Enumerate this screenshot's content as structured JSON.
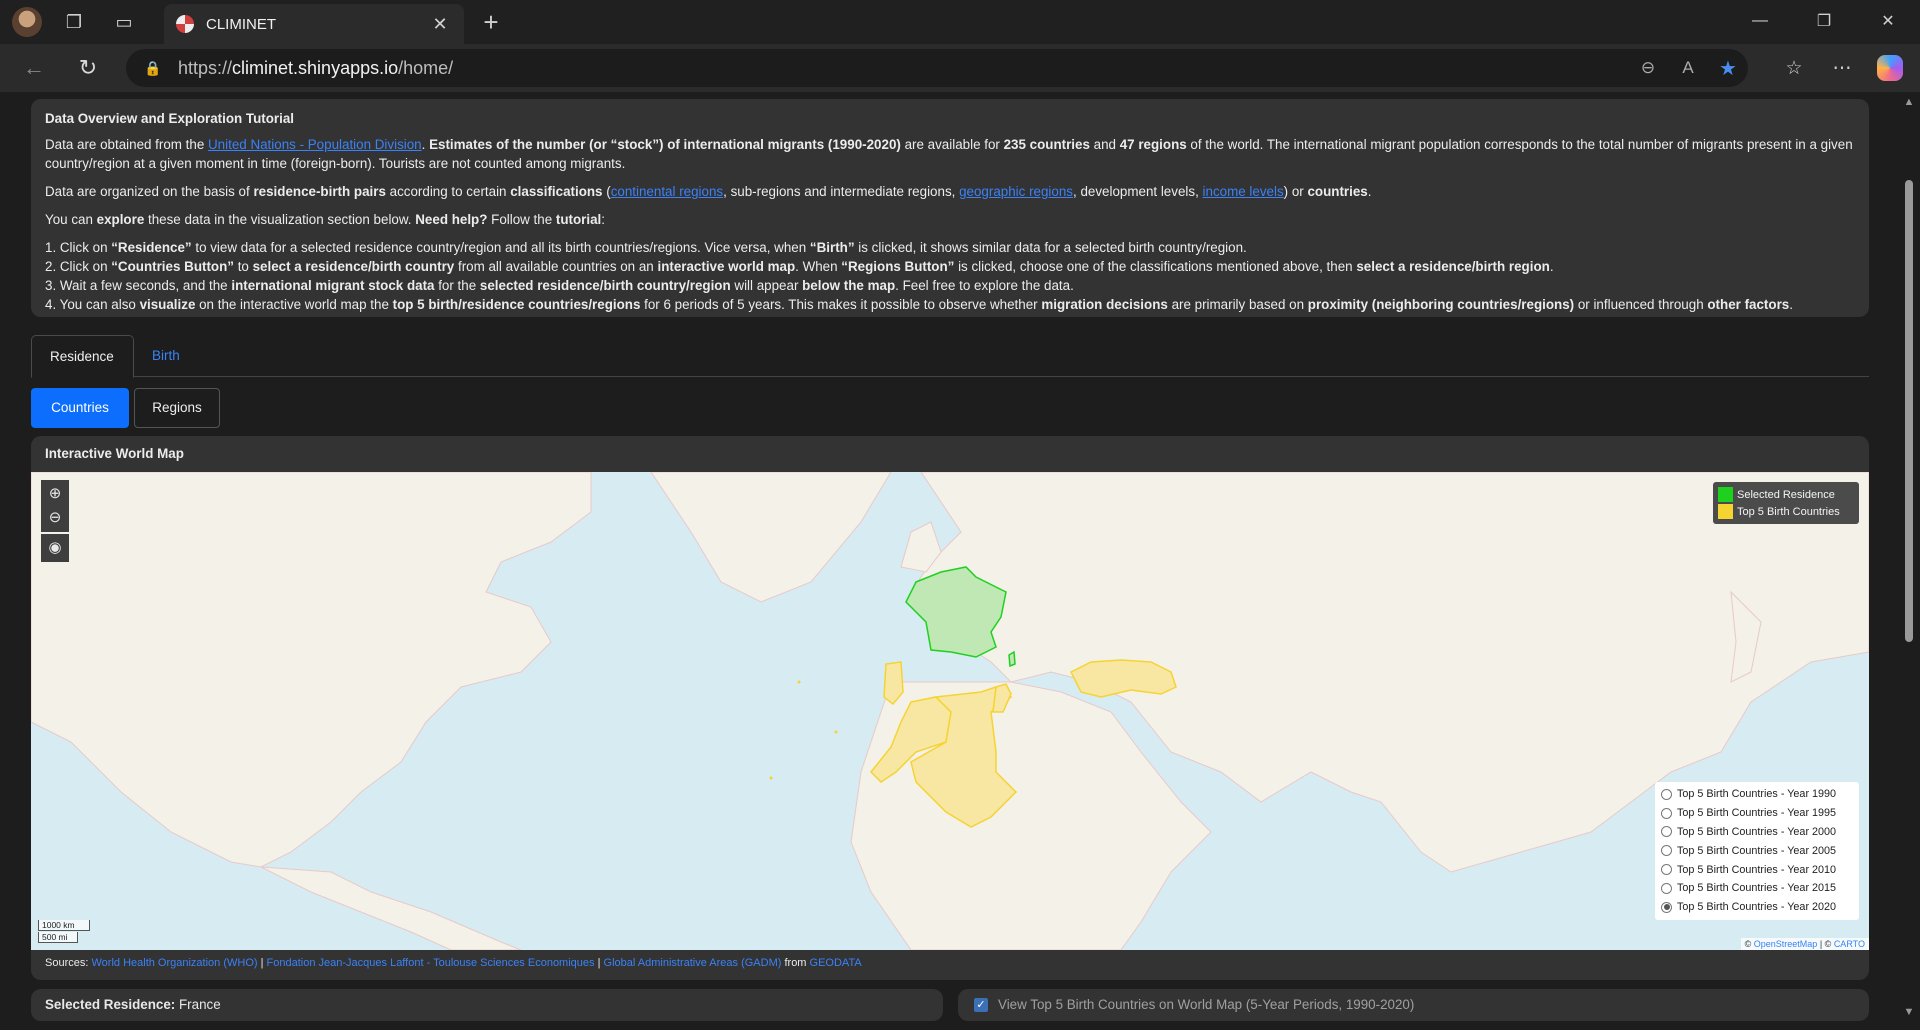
{
  "browser": {
    "tab_title": "CLIMINET",
    "url_prefix": "https://",
    "url_host": "climinet.shinyapps.io",
    "url_path": "/home/"
  },
  "tutorial": {
    "title": "Data Overview and Exploration Tutorial",
    "p1_a": "Data are obtained from the ",
    "p1_link": "United Nations - Population Division",
    "p1_b": ". ",
    "p1_bold1": "Estimates of the number (or “stock”) of international migrants (1990-2020)",
    "p1_c": " are available for ",
    "p1_bold2": "235 countries",
    "p1_d": " and ",
    "p1_bold3": "47 regions",
    "p1_e": " of the world. The international migrant population corresponds to the total number of migrants present in a given country/region at a given moment in time (foreign-born). Tourists are not counted among migrants.",
    "p2_a": "Data are organized on the basis of ",
    "p2_bold1": "residence-birth pairs",
    "p2_b": " according to certain ",
    "p2_bold2": "classifications",
    "p2_c": " (",
    "p2_link1": "continental regions",
    "p2_d": ", sub-regions and intermediate regions, ",
    "p2_link2": "geographic regions",
    "p2_e": ", development levels, ",
    "p2_link3": "income levels",
    "p2_f": ") or ",
    "p2_bold3": "countries",
    "p2_g": ".",
    "p3_a": "You can ",
    "p3_bold1": "explore",
    "p3_b": " these data in the visualization section below. ",
    "p3_bold2": "Need help?",
    "p3_c": " Follow the ",
    "p3_bold3": "tutorial",
    "p3_d": ":",
    "s1_a": "1. Click on ",
    "s1_bold1": "“Residence”",
    "s1_b": " to view data for a selected residence country/region and all its birth countries/regions. Vice versa, when ",
    "s1_bold2": "“Birth”",
    "s1_c": " is clicked, it shows similar data for a selected birth country/region.",
    "s2_a": "2. Click on ",
    "s2_bold1": "“Countries Button”",
    "s2_b": " to ",
    "s2_bold2": "select a residence/birth country",
    "s2_c": " from all available countries on an ",
    "s2_bold3": "interactive world map",
    "s2_d": ". When ",
    "s2_bold4": "“Regions Button”",
    "s2_e": " is clicked, choose one of the classifications mentioned above, then ",
    "s2_bold5": "select a residence/birth region",
    "s2_f": ".",
    "s3_a": "3. Wait a few seconds, and the ",
    "s3_bold1": "international migrant stock data",
    "s3_b": " for the ",
    "s3_bold2": "selected residence/birth country/region",
    "s3_c": " will appear ",
    "s3_bold3": "below the map",
    "s3_d": ". Feel free to explore the data.",
    "s4_a": "4. You can also ",
    "s4_bold1": "visualize",
    "s4_b": " on the interactive world map the ",
    "s4_bold2": "top 5 birth/residence countries/regions",
    "s4_c": " for 6 periods of 5 years. This makes it possible to observe whether ",
    "s4_bold3": "migration decisions",
    "s4_d": " are primarily based on ",
    "s4_bold4": "proximity (neighboring countries/regions)",
    "s4_e": " or influenced through ",
    "s4_bold5": "other factors",
    "s4_f": "."
  },
  "tabs": {
    "residence": "Residence",
    "birth": "Birth"
  },
  "buttons": {
    "countries": "Countries",
    "regions": "Regions"
  },
  "map": {
    "title": "Interactive World Map",
    "zoom_in": "+",
    "zoom_out": "−",
    "legend_selected": "Selected Residence",
    "legend_top5": "Top 5 Birth Countries",
    "colors": {
      "selected": "#1fd11f",
      "top5": "#f5d432",
      "selected_fill": "#bfe8b4",
      "top5_fill": "#f8e6a3"
    },
    "years": [
      "Top 5 Birth Countries - Year 1990",
      "Top 5 Birth Countries - Year 1995",
      "Top 5 Birth Countries - Year 2000",
      "Top 5 Birth Countries - Year 2005",
      "Top 5 Birth Countries - Year 2010",
      "Top 5 Birth Countries - Year 2015",
      "Top 5 Birth Countries - Year 2020"
    ],
    "selected_year": "Top 5 Birth Countries - Year 2020",
    "scale_km": "1000 km",
    "scale_mi": "500 mi",
    "attrib_link1": "OpenStreetMap",
    "attrib_sep": "|",
    "attrib_link2": "CARTO",
    "sources_label": "Sources:",
    "source1": "World Health Organization (WHO)",
    "source2": "Fondation Jean-Jacques Laffont - Toulouse Sciences Economiques",
    "source3": "Global Administrative Areas (GADM)",
    "sources_from": "from",
    "source4": "GEODATA"
  },
  "bottom": {
    "selected_label": "Selected Residence:",
    "selected_value": "France",
    "toggle_label": "View Top 5 Birth Countries on World Map (5-Year Periods, 1990-2020)"
  }
}
